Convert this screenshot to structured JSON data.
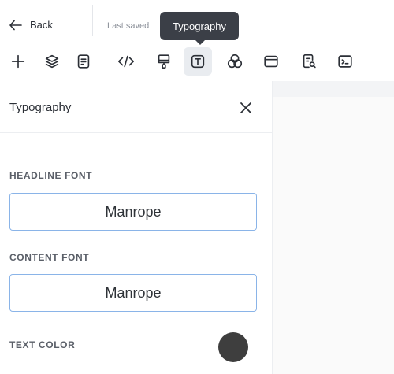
{
  "header": {
    "back_label": "Back",
    "saved_text": "Last saved",
    "tooltip": "Typography"
  },
  "toolbar": {
    "tools": [
      {
        "name": "add-icon",
        "active": false
      },
      {
        "name": "layers-icon",
        "active": false
      },
      {
        "name": "page-icon",
        "active": false
      },
      {
        "name": "code-icon",
        "active": false
      },
      {
        "name": "paint-roller-icon",
        "active": false
      },
      {
        "name": "typography-icon",
        "active": true
      },
      {
        "name": "color-circles-icon",
        "active": false
      },
      {
        "name": "layout-icon",
        "active": false
      },
      {
        "name": "document-search-icon",
        "active": false
      },
      {
        "name": "terminal-icon",
        "active": false
      }
    ]
  },
  "panel": {
    "title": "Typography",
    "headline_label": "HEADLINE FONT",
    "headline_value": "Manrope",
    "content_label": "CONTENT FONT",
    "content_value": "Manrope",
    "text_color_label": "TEXT COLOR",
    "text_color": "#3e3e3e",
    "field_border_color": "#8ab4e8"
  }
}
